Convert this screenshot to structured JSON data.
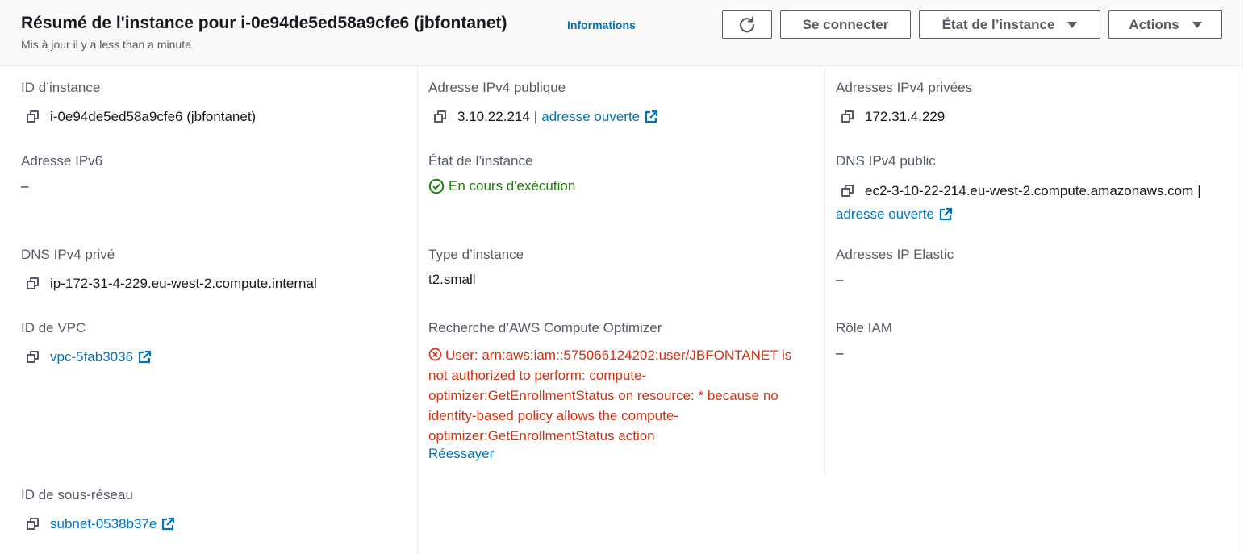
{
  "header": {
    "title": "Résumé de l'instance pour i-0e94de5ed58a9cfe6 (jbfontanet)",
    "info_link": "Informations",
    "updated": "Mis à jour il y a less than a minute",
    "buttons": {
      "refresh_icon": "refresh-icon",
      "connect": "Se connecter",
      "instance_state": "État de l’instance",
      "actions": "Actions"
    }
  },
  "fields": {
    "instance_id": {
      "label": "ID d’instance",
      "value": "i-0e94de5ed58a9cfe6 (jbfontanet)"
    },
    "public_ipv4": {
      "label": "Adresse IPv4 publique",
      "value": "3.10.22.214",
      "link": "adresse ouverte"
    },
    "private_ipv4": {
      "label": "Adresses IPv4 privées",
      "value": "172.31.4.229"
    },
    "ipv6": {
      "label": "Adresse IPv6",
      "value": "–"
    },
    "instance_state": {
      "label": "État de l’instance",
      "value": "En cours d'exécution"
    },
    "public_dns": {
      "label": "DNS IPv4 public",
      "value": "ec2-3-10-22-214.eu-west-2.compute.amazonaws.com",
      "link": "adresse ouverte"
    },
    "private_dns": {
      "label": "DNS IPv4 privé",
      "value": "ip-172-31-4-229.eu-west-2.compute.internal"
    },
    "instance_type": {
      "label": "Type d’instance",
      "value": "t2.small"
    },
    "elastic_ip": {
      "label": "Adresses IP Elastic",
      "value": "–"
    },
    "vpc_id": {
      "label": "ID de VPC",
      "value": "vpc-5fab3036"
    },
    "compute_optimizer": {
      "label": "Recherche d’AWS Compute Optimizer",
      "error": "User: arn:aws:iam::575066124202:user/JBFONTANET is not authorized to perform: compute-optimizer:GetEnrollmentStatus on resource: * because no identity-based policy allows the compute-optimizer:GetEnrollmentStatus action",
      "retry": "Réessayer"
    },
    "iam_role": {
      "label": "Rôle IAM",
      "value": "–"
    },
    "subnet_id": {
      "label": "ID de sous-réseau",
      "value": "subnet-0538b37e"
    }
  },
  "colors": {
    "link": "#0073bb",
    "success": "#1d8102",
    "error": "#d13212",
    "label": "#545b64"
  }
}
